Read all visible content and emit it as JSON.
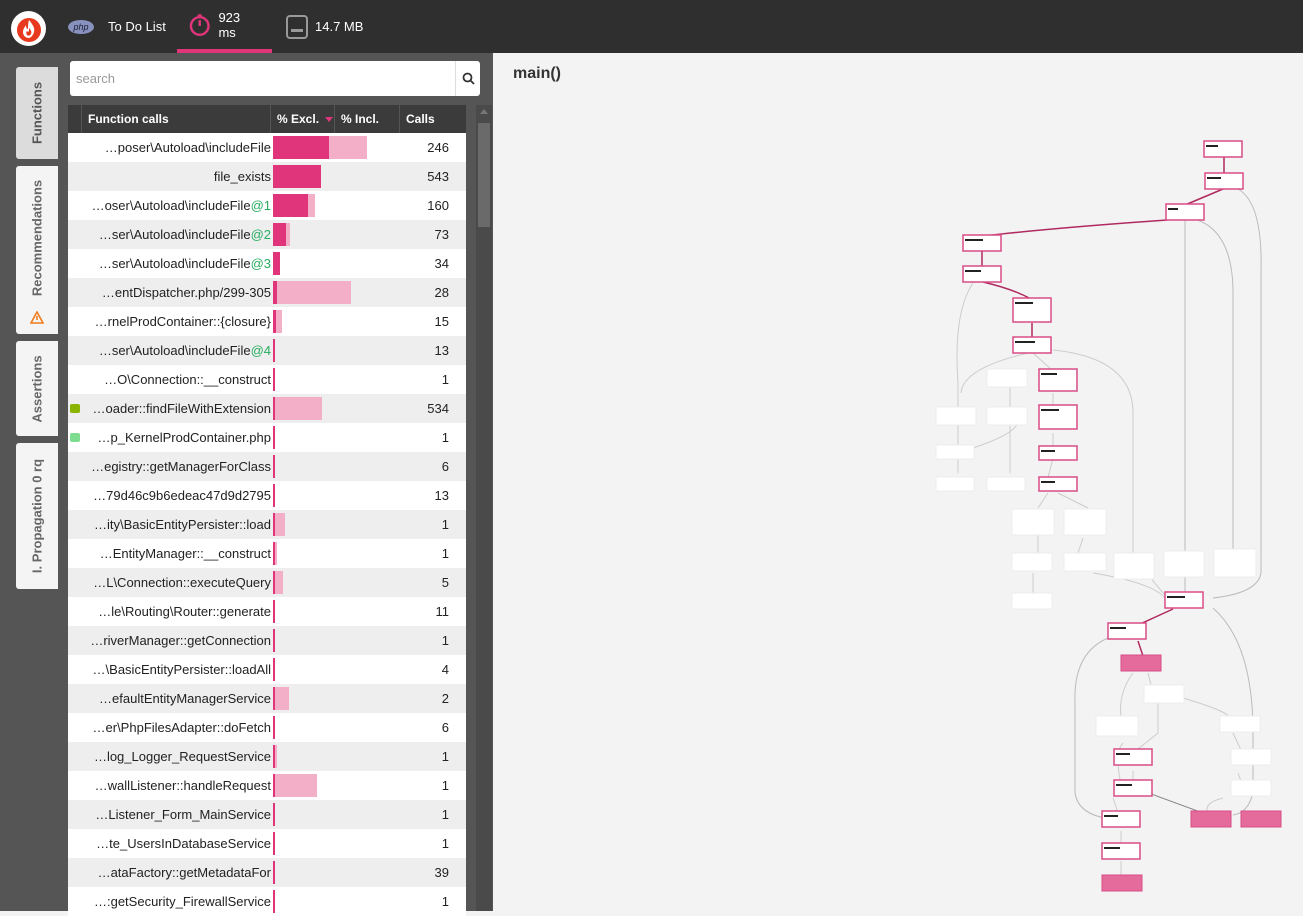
{
  "header": {
    "app_label": "php",
    "project": "To Do List",
    "time": "923 ms",
    "memory": "14.7 MB"
  },
  "sidebar": {
    "tabs": [
      {
        "label": "Functions"
      },
      {
        "label": "Recommendations"
      },
      {
        "label": "Assertions"
      },
      {
        "label": "I. Propagation 0 rq"
      }
    ]
  },
  "search": {
    "placeholder": "search"
  },
  "table": {
    "columns": [
      "Function calls",
      "% Excl.",
      "% Incl.",
      "Calls"
    ],
    "rows": [
      {
        "name": "…poser\\Autoload\\includeFile",
        "suffix": "",
        "excl": 0.43,
        "incl": 0.72,
        "calls": "246"
      },
      {
        "name": "file_exists",
        "suffix": "",
        "excl": 0.37,
        "incl": 0.37,
        "calls": "543"
      },
      {
        "name": "…oser\\Autoload\\includeFile",
        "suffix": "@1",
        "excl": 0.27,
        "incl": 0.32,
        "calls": "160"
      },
      {
        "name": "…ser\\Autoload\\includeFile",
        "suffix": "@2",
        "excl": 0.1,
        "incl": 0.13,
        "calls": "73"
      },
      {
        "name": "…ser\\Autoload\\includeFile",
        "suffix": "@3",
        "excl": 0.05,
        "incl": 0.05,
        "calls": "34"
      },
      {
        "name": "…entDispatcher.php/299-305",
        "suffix": "",
        "excl": 0.03,
        "incl": 0.6,
        "calls": "28"
      },
      {
        "name": "…rnelProdContainer::{closure}",
        "suffix": "",
        "excl": 0.02,
        "incl": 0.07,
        "calls": "15"
      },
      {
        "name": "…ser\\Autoload\\includeFile",
        "suffix": "@4",
        "excl": 0.015,
        "incl": 0.015,
        "calls": "13"
      },
      {
        "name": "…O\\Connection::__construct",
        "suffix": "",
        "excl": 0.015,
        "incl": 0.015,
        "calls": "1"
      },
      {
        "name": "…oader::findFileWithExtension",
        "suffix": "",
        "excl": 0.015,
        "incl": 0.38,
        "calls": "534",
        "dot": "#8ab400"
      },
      {
        "name": "…p_KernelProdContainer.php",
        "suffix": "",
        "excl": 0.01,
        "incl": 0.01,
        "calls": "1",
        "dot": "#7ddc8f"
      },
      {
        "name": "…egistry::getManagerForClass",
        "suffix": "",
        "excl": 0.01,
        "incl": 0.01,
        "calls": "6"
      },
      {
        "name": "…79d46c9b6edeac47d9d2795",
        "suffix": "",
        "excl": 0.01,
        "incl": 0.01,
        "calls": "13"
      },
      {
        "name": "…ity\\BasicEntityPersister::load",
        "suffix": "",
        "excl": 0.01,
        "incl": 0.09,
        "calls": "1"
      },
      {
        "name": "…EntityManager::__construct",
        "suffix": "",
        "excl": 0.01,
        "incl": 0.03,
        "calls": "1"
      },
      {
        "name": "…L\\Connection::executeQuery",
        "suffix": "",
        "excl": 0.01,
        "incl": 0.08,
        "calls": "5"
      },
      {
        "name": "…le\\Routing\\Router::generate",
        "suffix": "",
        "excl": 0.01,
        "incl": 0.01,
        "calls": "11"
      },
      {
        "name": "…riverManager::getConnection",
        "suffix": "",
        "excl": 0.01,
        "incl": 0.01,
        "calls": "1"
      },
      {
        "name": "…\\BasicEntityPersister::loadAll",
        "suffix": "",
        "excl": 0.01,
        "incl": 0.01,
        "calls": "4"
      },
      {
        "name": "…efaultEntityManagerService",
        "suffix": "",
        "excl": 0.01,
        "incl": 0.12,
        "calls": "2"
      },
      {
        "name": "…er\\PhpFilesAdapter::doFetch",
        "suffix": "",
        "excl": 0.01,
        "incl": 0.01,
        "calls": "6"
      },
      {
        "name": "…log_Logger_RequestService",
        "suffix": "",
        "excl": 0.01,
        "incl": 0.03,
        "calls": "1"
      },
      {
        "name": "…wallListener::handleRequest",
        "suffix": "",
        "excl": 0.01,
        "incl": 0.34,
        "calls": "1"
      },
      {
        "name": "…Listener_Form_MainService",
        "suffix": "",
        "excl": 0.01,
        "incl": 0.01,
        "calls": "1"
      },
      {
        "name": "…te_UsersInDatabaseService",
        "suffix": "",
        "excl": 0.01,
        "incl": 0.01,
        "calls": "1"
      },
      {
        "name": "…ataFactory::getMetadataFor",
        "suffix": "",
        "excl": 0.01,
        "incl": 0.01,
        "calls": "39"
      },
      {
        "name": "…:getSecurity_FirewallService",
        "suffix": "",
        "excl": 0.01,
        "incl": 0.01,
        "calls": "1"
      }
    ]
  },
  "graph": {
    "title": "main()"
  },
  "colors": {
    "accent": "#e0357a",
    "incl_bar": "#f3aec8",
    "topbar": "#2f2f2f",
    "panel": "#555555"
  }
}
